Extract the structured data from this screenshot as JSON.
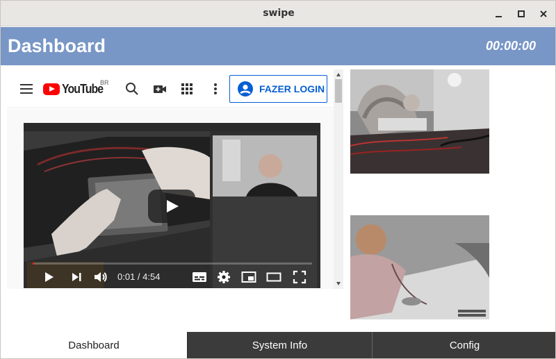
{
  "window": {
    "title": "swipe",
    "controls": [
      "minimize-icon",
      "maximize-icon",
      "close-icon"
    ]
  },
  "header": {
    "title": "Dashboard",
    "timer": "00:00:00",
    "color": "#7896c6"
  },
  "youtube": {
    "logo_text": "YouTube",
    "country_code": "BR",
    "icons": [
      "menu-icon",
      "search-icon",
      "create-video-icon",
      "apps-grid-icon",
      "more-vert-icon"
    ],
    "login_label": "FAZER LOGIN",
    "accent_color": "#065fd4",
    "player": {
      "current_time": "0:01",
      "duration": "4:54",
      "timecode": "0:01 / 4:54",
      "progress_fraction": 0.003,
      "controls": [
        "play-icon",
        "next-icon",
        "volume-icon",
        "subtitles-icon",
        "settings-icon",
        "miniplayer-icon",
        "theater-icon",
        "fullscreen-icon"
      ]
    }
  },
  "cameras": [
    {
      "name": "camera-feed-1"
    },
    {
      "name": "camera-feed-2"
    }
  ],
  "bottom_nav": {
    "tabs": [
      {
        "label": "Dashboard",
        "active": true
      },
      {
        "label": "System Info",
        "active": false
      },
      {
        "label": "Config",
        "active": false
      }
    ]
  }
}
